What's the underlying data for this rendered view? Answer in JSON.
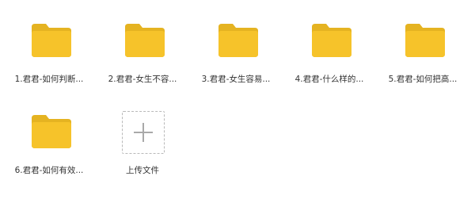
{
  "files": [
    {
      "label": "1.君君-如何判断..."
    },
    {
      "label": "2.君君-女生不容..."
    },
    {
      "label": "3.君君-女生容易..."
    },
    {
      "label": "4.君君-什么样的..."
    },
    {
      "label": "5.君君-如何把高..."
    },
    {
      "label": "6.君君-如何有效..."
    }
  ],
  "upload": {
    "label": "上传文件",
    "icon": "plus-icon"
  },
  "colors": {
    "folder_back": "#E5B321",
    "folder_front": "#F6C32A",
    "label_text": "#333333",
    "upload_border": "#B9B9B9"
  }
}
